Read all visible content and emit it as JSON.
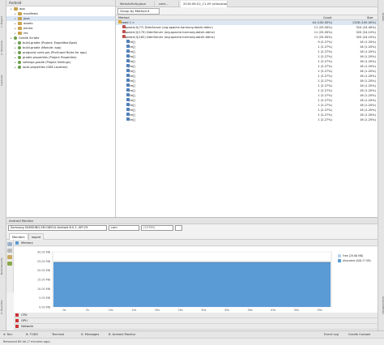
{
  "left_strip": {
    "items": [
      "1: Project",
      "2: Structure",
      "Captures",
      "Build Variants",
      "2: Favorites"
    ]
  },
  "right_strip": {
    "items": [
      "Gradle",
      "Android Model"
    ]
  },
  "project": {
    "toolbar_label": "Android",
    "tree": [
      {
        "label": "app",
        "indent": 1,
        "kind": "folder",
        "selected": false
      },
      {
        "label": "manifests",
        "indent": 2,
        "kind": "folder",
        "selected": false
      },
      {
        "label": "java",
        "indent": 2,
        "kind": "folder",
        "selected": true
      },
      {
        "label": "assets",
        "indent": 2,
        "kind": "folder",
        "selected": false
      },
      {
        "label": "jniLibs",
        "indent": 2,
        "kind": "folder",
        "selected": false
      },
      {
        "label": "res",
        "indent": 2,
        "kind": "folder",
        "selected": false
      },
      {
        "label": "Gradle Scripts",
        "indent": 1,
        "kind": "gradle",
        "selected": false
      },
      {
        "label": "build.gradle (Project: ExpeditionSpot)",
        "indent": 2,
        "kind": "gradle",
        "selected": false
      },
      {
        "label": "build.gradle (Module: app)",
        "indent": 2,
        "kind": "gradle",
        "selected": false
      },
      {
        "label": "proguard-rules.pro (ProGuard Rules for app)",
        "indent": 2,
        "kind": "gradle",
        "selected": false
      },
      {
        "label": "gradle.properties (Project Properties)",
        "indent": 2,
        "kind": "gradle",
        "selected": false
      },
      {
        "label": "settings.gradle (Project Settings)",
        "indent": 2,
        "kind": "gradle",
        "selected": false
      },
      {
        "label": "local.properties (SDK Location)",
        "indent": 2,
        "kind": "gradle",
        "selected": false
      }
    ]
  },
  "editor_tabs": [
    {
      "label": "MainActivity.java",
      "active": false
    },
    {
      "label": "com...",
      "active": false
    },
    {
      "label": "2016.08.02_11.09 (allocation)",
      "active": true
    }
  ],
  "alloc": {
    "group_by": "Group by Method ▾",
    "columns": {
      "method": "Method",
      "count": "Count",
      "size": "Size"
    },
    "rows": [
      {
        "method": "Thread 1 >",
        "indent": 0,
        "icon": "thread",
        "count": "44 (100.00%)",
        "size": "1328 (100.00%)"
      },
      {
        "method": "dispatch(I)(77) DdmServer (org.apache.harmony.dalvik.ddmc)",
        "indent": 1,
        "icon": "method",
        "count": "11 (25.00%)",
        "size": "324 (24.40%)"
      },
      {
        "method": "dispatch(I)(175) DdmServer (org.apache.harmony.dalvik.ddmc)",
        "indent": 1,
        "icon": "method",
        "count": "11 (25.00%)",
        "size": "320 (24.10%)"
      },
      {
        "method": "dispatch(I)(162) DdmServer (org.apache.harmony.dalvik.ddmc)",
        "indent": 1,
        "icon": "method",
        "count": "11 (25.00%)",
        "size": "320 (24.10%)"
      },
      {
        "method": "byte[]",
        "indent": 2,
        "icon": "class",
        "count": "9 (2.27%)",
        "size": "16 (1.20%)"
      },
      {
        "method": "byte[]",
        "indent": 2,
        "icon": "class",
        "count": "1 (2.27%)",
        "size": "16 (1.20%)"
      },
      {
        "method": "byte[]",
        "indent": 2,
        "icon": "class",
        "count": "1 (2.27%)",
        "size": "16 (1.20%)"
      },
      {
        "method": "byte[]",
        "indent": 2,
        "icon": "class",
        "count": "1 (2.27%)",
        "size": "16 (1.20%)"
      },
      {
        "method": "byte[]",
        "indent": 2,
        "icon": "class",
        "count": "1 (2.27%)",
        "size": "16 (1.20%)"
      },
      {
        "method": "byte[]",
        "indent": 2,
        "icon": "class",
        "count": "1 (2.27%)",
        "size": "16 (1.20%)"
      },
      {
        "method": "byte[]",
        "indent": 2,
        "icon": "class",
        "count": "1 (2.27%)",
        "size": "16 (1.20%)"
      },
      {
        "method": "byte[]",
        "indent": 2,
        "icon": "class",
        "count": "1 (2.27%)",
        "size": "16 (1.20%)"
      },
      {
        "method": "byte[]",
        "indent": 2,
        "icon": "class",
        "count": "1 (2.27%)",
        "size": "16 (1.20%)"
      },
      {
        "method": "byte[]",
        "indent": 2,
        "icon": "class",
        "count": "1 (2.27%)",
        "size": "16 (1.20%)"
      },
      {
        "method": "byte[]",
        "indent": 2,
        "icon": "class",
        "count": "1 (2.27%)",
        "size": "16 (1.20%)"
      },
      {
        "method": "byte[]",
        "indent": 2,
        "icon": "class",
        "count": "1 (2.27%)",
        "size": "16 (1.20%)"
      },
      {
        "method": "byte[]",
        "indent": 2,
        "icon": "class",
        "count": "1 (2.27%)",
        "size": "16 (1.20%)"
      },
      {
        "method": "byte[]",
        "indent": 2,
        "icon": "class",
        "count": "1 (2.27%)",
        "size": "16 (1.20%)"
      },
      {
        "method": "byte[]",
        "indent": 2,
        "icon": "class",
        "count": "1 (2.27%)",
        "size": "16 (1.20%)"
      },
      {
        "method": "byte[]",
        "indent": 2,
        "icon": "class",
        "count": "1 (2.27%)",
        "size": "16 (1.20%)"
      },
      {
        "method": "byte[]",
        "indent": 2,
        "icon": "class",
        "count": "1 (2.27%)",
        "size": "16 (1.20%)"
      }
    ]
  },
  "monitor": {
    "title": "Android Monitor",
    "device": "Samsung SAMSUNG-SM-G891A Android 6.0.1, API 23",
    "process": "com",
    "pid": "(25789)",
    "tabs": [
      {
        "label": "Monitors",
        "active": true
      },
      {
        "label": "logcat",
        "active": false
      }
    ],
    "memory": {
      "label": "Memory",
      "legend": [
        {
          "label": "Free (29.68 MB)",
          "color": "#b9d3ec"
        },
        {
          "label": "Allocated (408.17 KB)",
          "color": "#5b9bd5"
        }
      ],
      "y_ticks": [
        "30.00 MB",
        "25.00 MB",
        "20.00 MB",
        "15.00 MB",
        "10.00 MB",
        "5.00 MB",
        "0.00 MB"
      ],
      "x_ticks": [
        "0s",
        "5s",
        "10s",
        "15s",
        "20s",
        "25s",
        "30s",
        "35s",
        "40s",
        "45s",
        "50s",
        "55s"
      ]
    },
    "sections": [
      "CPU",
      "GPU",
      "Network"
    ]
  },
  "colors": {
    "memory_fill": "#5b9bd5",
    "memory_top": "#3b6fa5",
    "selection": "#dbe6f5"
  },
  "bottom_tabs": [
    "4: Run",
    "6: TODO",
    "Terminal",
    "0: Messages",
    "6: Android Monitor"
  ],
  "bottom_right": [
    "Event Log",
    "Gradle Console"
  ],
  "status": "Removed 89 kb (7 minutes ago)"
}
